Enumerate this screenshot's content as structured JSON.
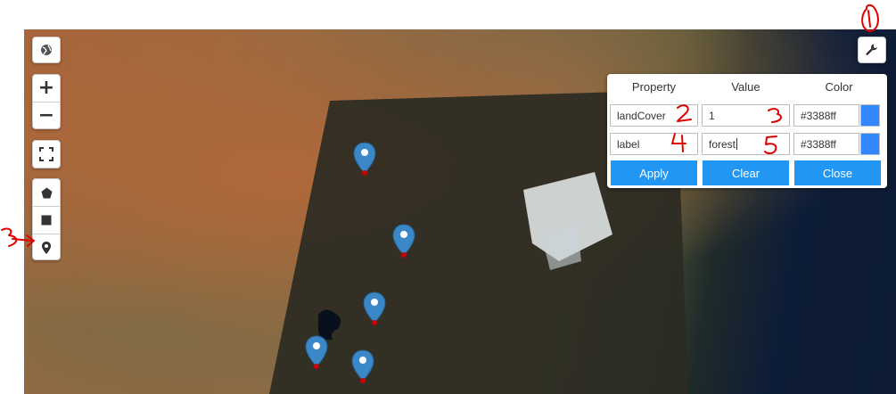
{
  "map": {
    "controls": {
      "layers_icon": "globe-icon",
      "zoom_in_label": "+",
      "zoom_out_label": "−",
      "fullscreen_icon": "fullscreen-icon",
      "draw_polygon_icon": "pentagon-icon",
      "draw_rectangle_icon": "square-icon",
      "draw_marker_icon": "map-pin-icon",
      "settings_icon": "wrench-icon"
    },
    "marker_color": "#3b88c9",
    "marker_dot_color": "#cc0000"
  },
  "panel": {
    "headers": {
      "property": "Property",
      "value": "Value",
      "color": "Color"
    },
    "rows": [
      {
        "property": "landCover",
        "value": "1",
        "color": "#3388ff",
        "swatch": "#3388ff"
      },
      {
        "property": "label",
        "value": "forest",
        "color": "#3388ff",
        "swatch": "#3388ff"
      }
    ],
    "buttons": {
      "apply": "Apply",
      "clear": "Clear",
      "close": "Close"
    },
    "accent": "#2196f3"
  },
  "annotations": {
    "color": "#e00000",
    "labels": [
      "1",
      "2",
      "3",
      "4",
      "5"
    ]
  }
}
